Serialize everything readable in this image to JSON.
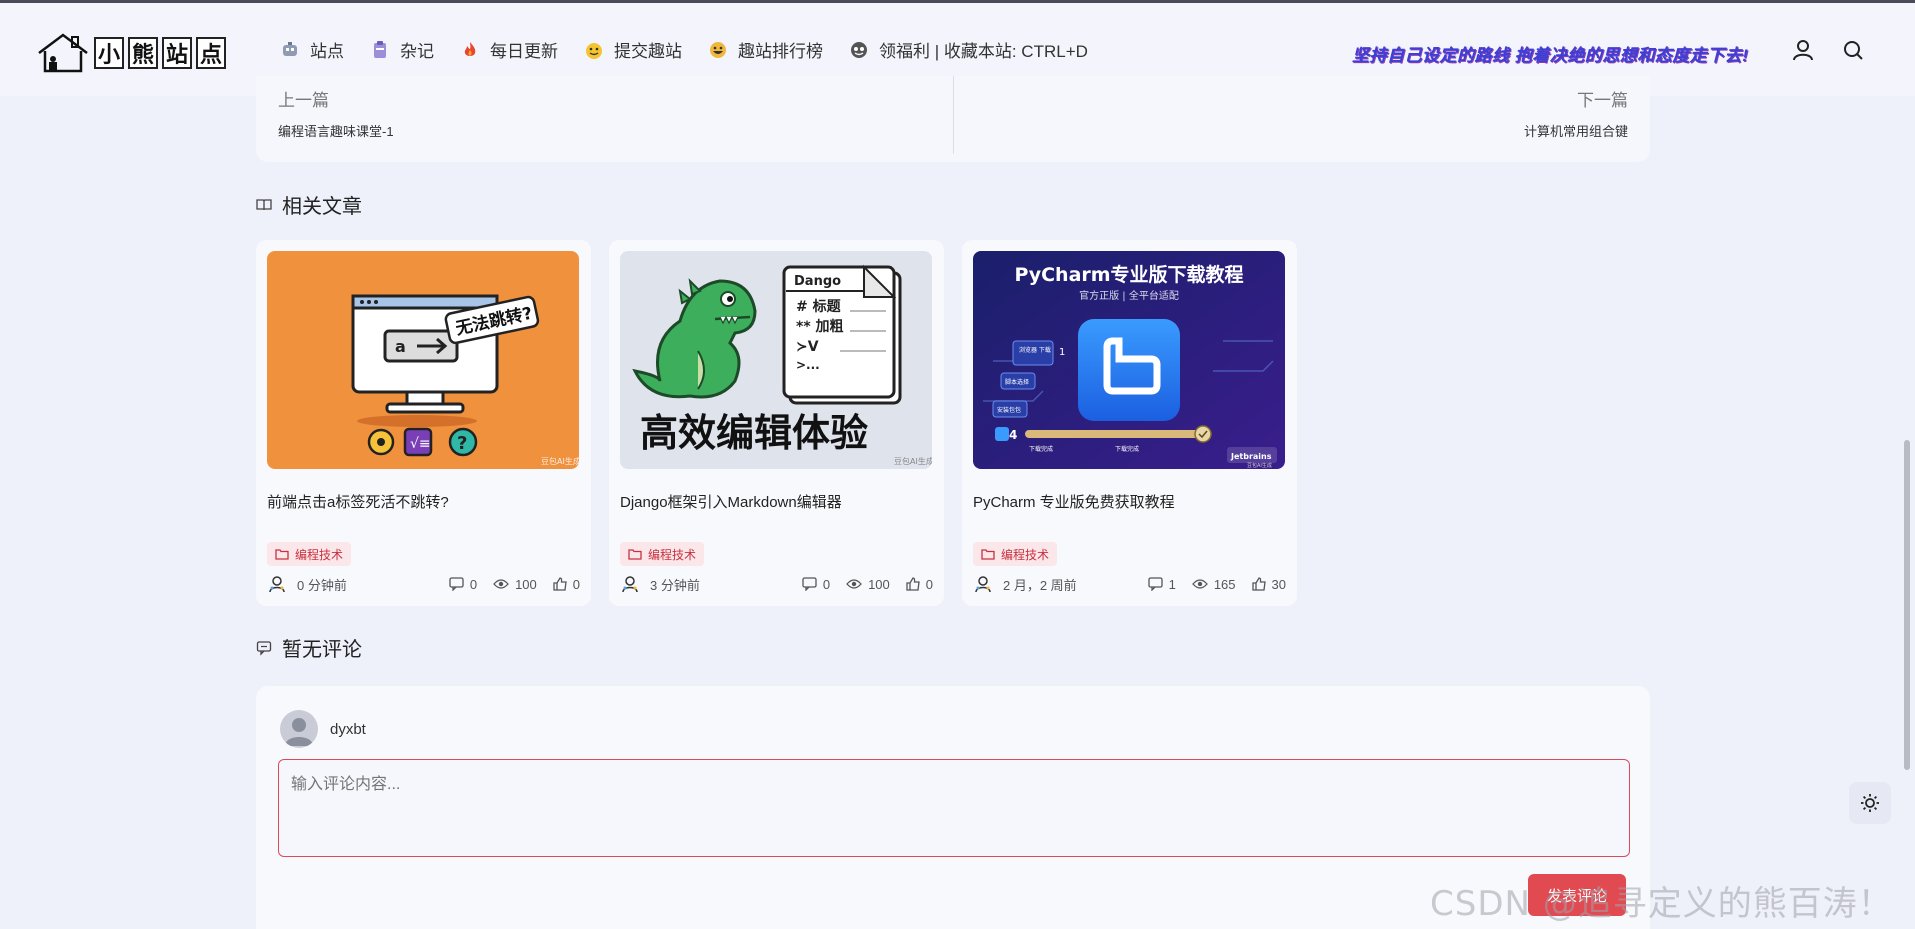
{
  "header": {
    "logo_chars": [
      "小",
      "熊",
      "站",
      "点"
    ],
    "nav": [
      {
        "label": "站点",
        "icon": "robot-icon"
      },
      {
        "label": "杂记",
        "icon": "clipboard-icon"
      },
      {
        "label": "每日更新",
        "icon": "fire-icon"
      },
      {
        "label": "提交趣站",
        "icon": "smile-icon"
      },
      {
        "label": "趣站排行榜",
        "icon": "grin-icon"
      },
      {
        "label": "领福利 | 收藏本站: CTRL+D",
        "icon": "gift-icon"
      }
    ],
    "slogan": "坚持自己设定的路线 抱着决绝的思想和态度走下去!",
    "icons": {
      "user": "user-icon",
      "search": "search-icon"
    }
  },
  "prevnext": {
    "prev_label": "上一篇",
    "prev_title": "编程语言趣味课堂-1",
    "next_label": "下一篇",
    "next_title": "计算机常用组合键"
  },
  "related": {
    "heading": "相关文章",
    "cards": [
      {
        "title": "前端点击a标签死活不跳转?",
        "tag": "编程技术",
        "time": "0 分钟前",
        "comments": "0",
        "views": "100",
        "likes": "0",
        "thumb": {
          "bubble": "无法跳转?",
          "btn": "a",
          "wm": "豆包AI生成"
        }
      },
      {
        "title": "Django框架引入Markdown编辑器",
        "tag": "编程技术",
        "time": "3 分钟前",
        "comments": "0",
        "views": "100",
        "likes": "0",
        "thumb": {
          "doc_title": "Dango",
          "line1": "# 标题",
          "line2": "** 加粗",
          "line3": "≻V",
          "line4": ">...",
          "caption": "高效编辑体验",
          "wm": "豆包AI生成"
        }
      },
      {
        "title": "PyCharm 专业版免费获取教程",
        "tag": "编程技术",
        "time": "2 月，2 周前",
        "comments": "1",
        "views": "165",
        "likes": "30",
        "thumb": {
          "title": "PyCharm专业版下载教程",
          "subtitle": "官方正版 | 全平台适配",
          "step1": "浏览器\n下载",
          "step2": "脚本选择",
          "step3": "安装包包",
          "brand": "Jetbrains",
          "num": "4",
          "num1": "1",
          "progress_left": "下载完成",
          "progress_right": "下载完成",
          "wm": "豆包AI生成"
        }
      }
    ]
  },
  "comments": {
    "heading": "暂无评论",
    "username": "dyxbt",
    "placeholder": "输入评论内容...",
    "submit": "发表评论"
  },
  "watermark": "CSDN @追寻定义的熊百涛！",
  "colors": {
    "accent": "#e24a52",
    "tag_bg": "#fbe7ea",
    "tag_text": "#c8313f",
    "slogan": "#3a3fd6"
  }
}
